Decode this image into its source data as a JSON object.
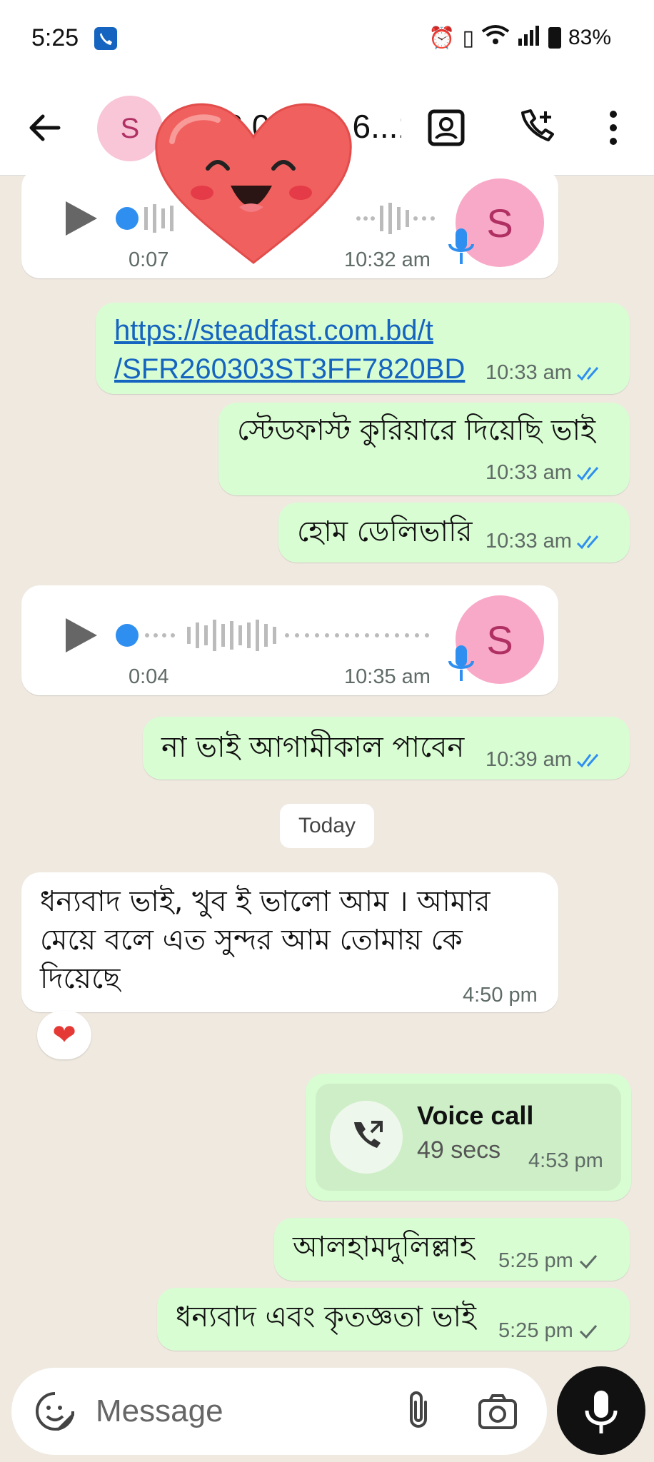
{
  "status": {
    "time": "5:25",
    "battery": "83%"
  },
  "header": {
    "avatar_letter": "S",
    "title": "+88 01836 6...1 6..."
  },
  "messages": [
    {
      "type": "voice",
      "duration": "0:07",
      "time": "10:32 am",
      "avatar": "S"
    },
    {
      "type": "link",
      "text_line1": "https://steadfast.com.bd/t",
      "text_line2": "/SFR260303ST3FF7820BD",
      "time": "10:33 am"
    },
    {
      "type": "text",
      "text": "স্টেডফাস্ট কুরিয়ারে দিয়েছি ভাই",
      "time": "10:33 am"
    },
    {
      "type": "text",
      "text": "হোম ডেলিভারি",
      "time": "10:33 am"
    },
    {
      "type": "voice",
      "duration": "0:04",
      "time": "10:35 am",
      "avatar": "S"
    },
    {
      "type": "text",
      "text": "না ভাই আগামীকাল পাবেন",
      "time": "10:39 am"
    },
    {
      "type": "text",
      "line1": "ধন্যবাদ ভাই, খুব ই ভালো আম । আমার",
      "line2": "মেয়ে বলে এত সুন্দর আম তোমায় কে",
      "line3": "দিয়েছে",
      "time": "4:50 pm",
      "reaction": "❤"
    },
    {
      "type": "call",
      "title": "Voice call",
      "duration": "49 secs",
      "time": "4:53 pm"
    },
    {
      "type": "text",
      "text": "আলহামদুলিল্লাহ",
      "time": "5:25 pm"
    },
    {
      "type": "text",
      "text": "ধন্যবাদ এবং কৃতজ্ঞতা ভাই",
      "time": "5:25 pm"
    }
  ],
  "day_divider": "Today",
  "composer": {
    "placeholder": "Message"
  },
  "colors": {
    "outgoing": "#d9fdd3",
    "incoming": "#ffffff",
    "tick_blue": "#2f8ff0",
    "background": "#efe9e0"
  }
}
